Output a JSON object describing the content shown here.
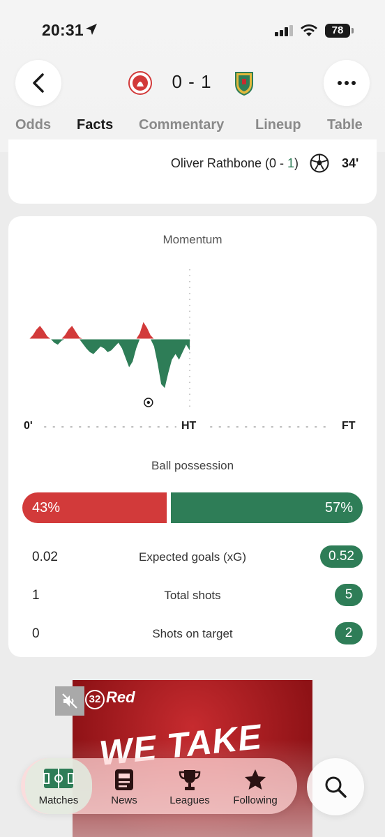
{
  "status_bar": {
    "time": "20:31",
    "battery": "78"
  },
  "header": {
    "score_home": "0",
    "score_sep": "-",
    "score_away": "1",
    "colors": {
      "home": "#d23a3a",
      "away": "#2e7d57"
    }
  },
  "tabs": [
    {
      "label": "Odds",
      "active": false
    },
    {
      "label": "Facts",
      "active": true
    },
    {
      "label": "Commentary",
      "active": false
    },
    {
      "label": "Lineup",
      "active": false
    },
    {
      "label": "Table",
      "active": false
    }
  ],
  "event": {
    "player": "Oliver Rathbone (0 - ",
    "score_highlight": "1",
    "closing": ")",
    "minute": "34'",
    "icon": "soccer-ball-icon"
  },
  "momentum": {
    "title": "Momentum",
    "labels": {
      "start": "0'",
      "half": "HT",
      "end": "FT"
    },
    "goal_icon": "soccer-ball-icon",
    "goal_minute": 34,
    "values": [
      0,
      4,
      10,
      14,
      9,
      3,
      0,
      -4,
      -6,
      -2,
      4,
      10,
      14,
      8,
      2,
      -5,
      -10,
      -14,
      -16,
      -12,
      -8,
      -10,
      -14,
      -12,
      -8,
      -4,
      -10,
      -20,
      -30,
      -24,
      -10,
      6,
      18,
      12,
      4,
      -8,
      -26,
      -48,
      -52,
      -36,
      -22,
      -16,
      -22,
      -14,
      -6,
      -12
    ]
  },
  "possession": {
    "title": "Ball possession",
    "home": "43%",
    "away": "57%",
    "home_value": 43,
    "away_value": 57
  },
  "stats": [
    {
      "home": "0.02",
      "label": "Expected goals (xG)",
      "away": "0.52"
    },
    {
      "home": "1",
      "label": "Total shots",
      "away": "5"
    },
    {
      "home": "0",
      "label": "Shots on target",
      "away": "2"
    }
  ],
  "ad": {
    "logo": "Red",
    "logo_num": "32",
    "headline": "WE TAKE"
  },
  "nav": [
    {
      "label": "Matches",
      "icon": "pitch-icon",
      "active": true
    },
    {
      "label": "News",
      "icon": "news-icon",
      "active": false
    },
    {
      "label": "Leagues",
      "icon": "trophy-icon",
      "active": false
    },
    {
      "label": "Following",
      "icon": "star-icon",
      "active": false
    }
  ]
}
